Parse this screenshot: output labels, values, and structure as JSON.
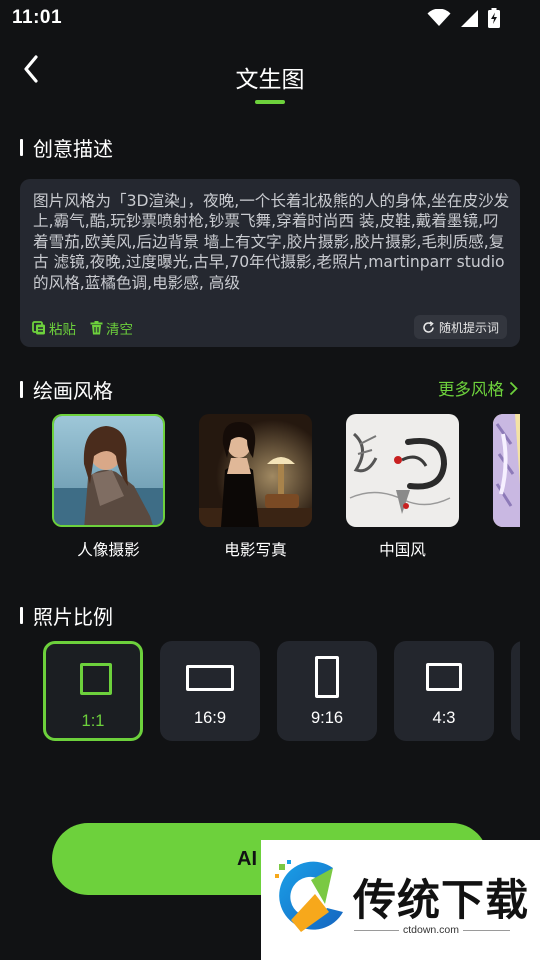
{
  "status_bar": {
    "time": "11:01",
    "icons": [
      "wifi-icon",
      "cellular-signal-icon",
      "battery-charging-icon"
    ]
  },
  "header": {
    "title": "文生图",
    "back_icon": "chevron-left-icon"
  },
  "sections": {
    "prompt_title": "创意描述",
    "style_title": "绘画风格",
    "ratio_title": "照片比例"
  },
  "prompt": {
    "text": "图片风格为「3D渲染」，夜晚,一个长着北极熊的人的身体,坐在皮沙发上,霸气,酷,玩钞票喷射枪,钞票飞舞,穿着时尚西 装,皮鞋,戴着墨镜,叼着雪茄,欧美风,后边背景 墙上有文字,胶片摄影,胶片摄影,毛刺质感,复古 滤镜,夜晚,过度曝光,古早,70年代摄影,老照片,martinparr studio的风格,蓝橘色调,电影感, 高级",
    "paste_label": "粘贴",
    "clear_label": "清空",
    "random_label": "随机提示词"
  },
  "styles": {
    "more_label": "更多风格",
    "items": [
      {
        "label": "人像摄影",
        "selected": true
      },
      {
        "label": "电影写真",
        "selected": false
      },
      {
        "label": "中国风",
        "selected": false
      },
      {
        "label": "",
        "selected": false
      }
    ]
  },
  "ratios": {
    "items": [
      {
        "label": "1:1",
        "selected": true
      },
      {
        "label": "16:9",
        "selected": false
      },
      {
        "label": "9:16",
        "selected": false
      },
      {
        "label": "4:3",
        "selected": false
      }
    ]
  },
  "generate": {
    "label": "AI"
  },
  "watermark": {
    "title": "传统下载",
    "url": "ctdown.com"
  },
  "colors": {
    "accent": "#6dd13c",
    "background": "#111214",
    "card": "#23262d"
  }
}
